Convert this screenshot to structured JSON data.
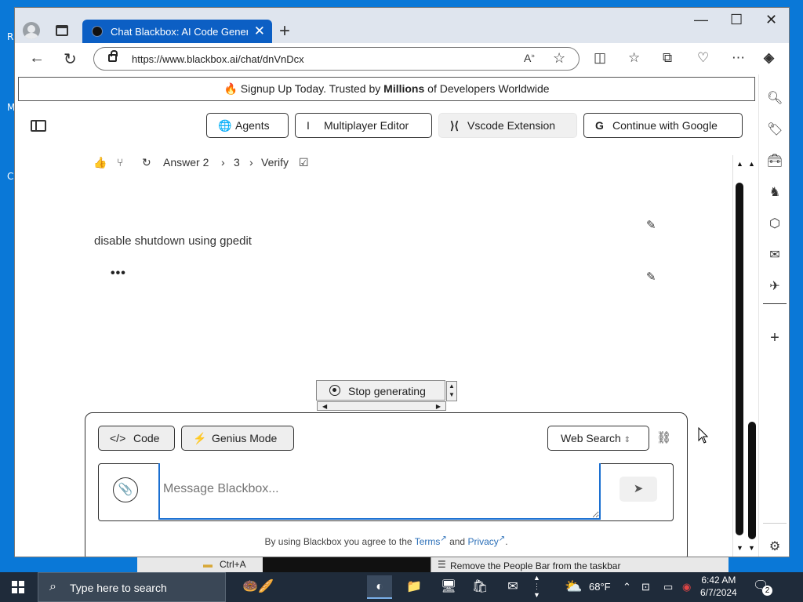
{
  "desktop": {
    "left_letters": [
      "R",
      "M",
      "C"
    ]
  },
  "browser": {
    "tab_title": "Chat Blackbox: AI Code Generati",
    "url": "https://www.blackbox.ai/chat/dnVnDcx"
  },
  "banner": {
    "prefix": "Signup Up Today. Trusted by ",
    "bold": "Millions",
    "suffix": " of Developers Worldwide"
  },
  "header": {
    "agents": "Agents",
    "multiplayer": "Multiplayer Editor",
    "vscode": "Vscode Extension",
    "google": "Continue with Google"
  },
  "actions": {
    "answer": "Answer 2",
    "page": "3",
    "verify": "Verify"
  },
  "chat": {
    "user_message": "disable shutdown using gpedit",
    "typing": "•••"
  },
  "stop": {
    "label": "Stop generating"
  },
  "composer": {
    "code": "Code",
    "genius": "Genius Mode",
    "web_search": "Web Search",
    "placeholder": "Message Blackbox...",
    "terms_prefix": "By using Blackbox you agree to the ",
    "terms": "Terms",
    "and": " and ",
    "privacy": "Privacy",
    "period": "."
  },
  "background": {
    "item1": "Ctrl+A",
    "item2": "Remove the People Bar from the taskbar"
  },
  "taskbar": {
    "search_placeholder": "Type here to search",
    "temperature": "68°F",
    "time": "6:42 AM",
    "date": "6/7/2024",
    "notifications": "2"
  }
}
